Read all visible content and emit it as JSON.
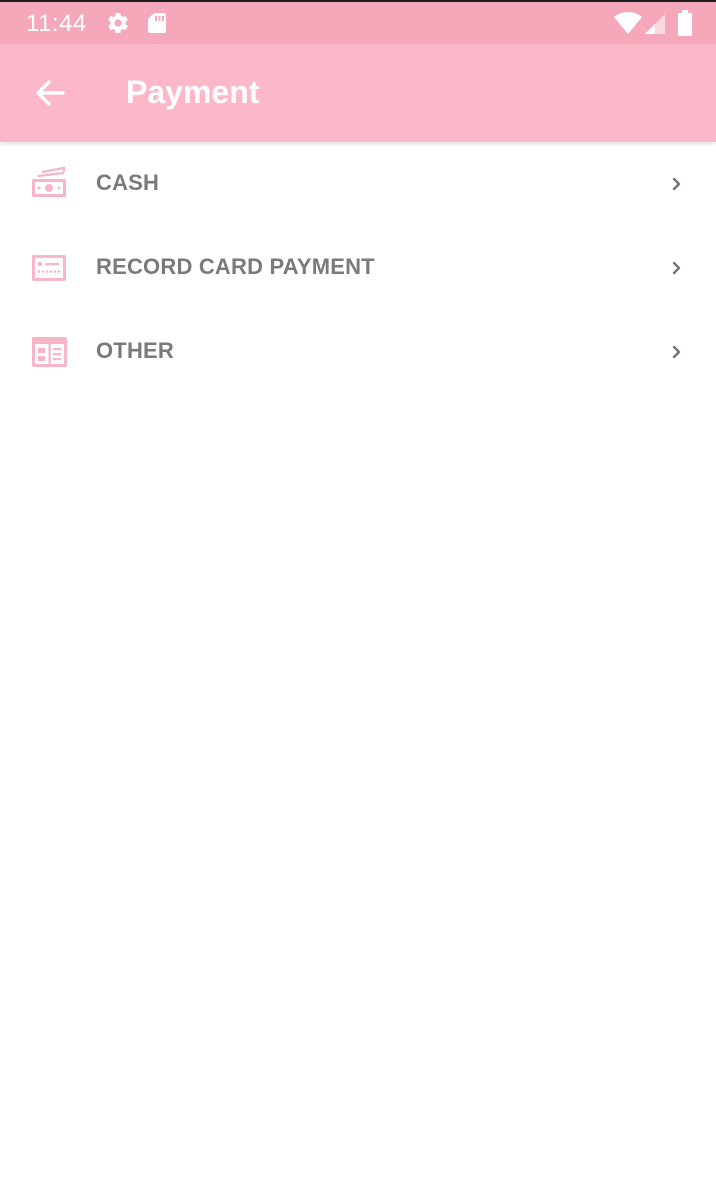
{
  "status_bar": {
    "time": "11:44",
    "icons": [
      "gear-icon",
      "sd-card-icon",
      "wifi-icon",
      "signal-icon",
      "battery-icon"
    ]
  },
  "app_bar": {
    "title": "Payment",
    "back_icon": "arrow-left-icon"
  },
  "payment_methods": [
    {
      "label": "CASH",
      "icon": "cash-icon"
    },
    {
      "label": "RECORD CARD PAYMENT",
      "icon": "card-icon"
    },
    {
      "label": "OTHER",
      "icon": "other-payment-icon"
    }
  ],
  "colors": {
    "status_bar": "#f5a8ba",
    "app_bar": "#fcb8c8",
    "icon_pink": "#f7b6c6",
    "label_gray": "#7a7a7a"
  }
}
